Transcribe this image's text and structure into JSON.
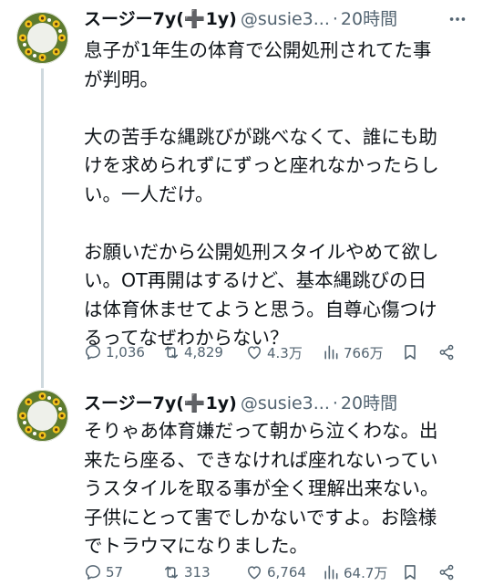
{
  "tweets": [
    {
      "display_name": "スージー7y(➕1y)",
      "handle": "@susie3...",
      "time": "20時間",
      "body": "息子が1年生の体育で公開処刑されてた事\nが判明。\n\n大の苦手な縄跳びが跳べなくて、誰にも助\nけを求められずにずっと座れなかったらし\nい。一人だけ。\n\nお願いだから公開処刑スタイルやめて欲し\nい。OT再開はするけど、基本縄跳びの日\nは体育休ませてようと思う。自尊心傷つけ\nるってなぜわからない？",
      "replies": "1,036",
      "reposts": "4,829",
      "likes": "4.3万",
      "views": "766万"
    },
    {
      "display_name": "スージー7y(➕1y)",
      "handle": "@susie3...",
      "time": "20時間",
      "body": "そりゃあ体育嫌だって朝から泣くわな。出\n来たら座る、できなければ座れないってい\nうスタイルを取る事が全く理解出来ない。\n子供にとって害でしかないですよ。お陰様\nでトラウマになりました。",
      "replies": "57",
      "reposts": "313",
      "likes": "6,764",
      "views": "64.7万"
    }
  ],
  "icons": {
    "more": "more-icon",
    "reply": "reply-icon",
    "repost": "repost-icon",
    "like": "heart-icon",
    "views": "views-chart-icon",
    "bookmark": "bookmark-icon",
    "share": "share-icon"
  },
  "colors": {
    "text": "#0f1419",
    "secondary": "#536471",
    "thread_line": "#cfd9de"
  }
}
